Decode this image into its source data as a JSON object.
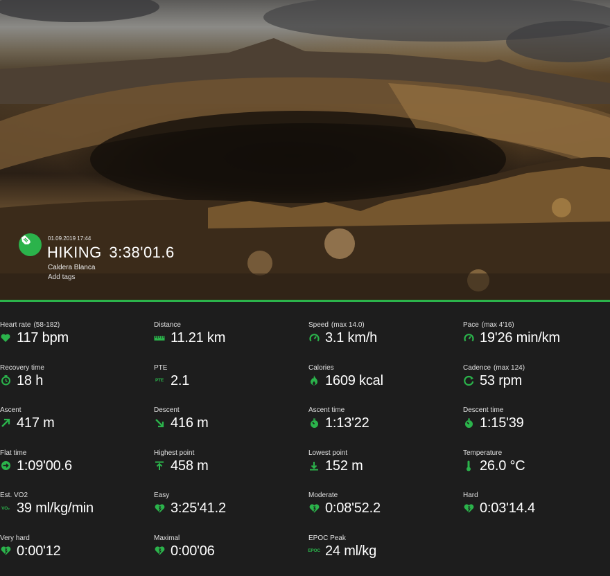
{
  "activity": {
    "date": "01.09.2019 17:44",
    "type": "HIKING",
    "duration": "3:38'01.6",
    "location": "Caldera Blanca",
    "add_tags": "Add tags",
    "icon": "hiking-boot-icon"
  },
  "colors": {
    "accent": "#2bb34b",
    "background": "#1d1d1d"
  },
  "stats": [
    {
      "label": "Heart rate",
      "sub": "(58-182)",
      "value": "117 bpm",
      "icon": "heart-icon"
    },
    {
      "label": "Distance",
      "sub": "",
      "value": "11.21 km",
      "icon": "ruler-icon"
    },
    {
      "label": "Speed",
      "sub": "(max  14.0)",
      "value": "3.1 km/h",
      "icon": "speedometer-icon"
    },
    {
      "label": "Pace",
      "sub": "(max  4'16)",
      "value": "19'26 min/km",
      "icon": "speedometer-icon"
    },
    {
      "label": "Recovery time",
      "sub": "",
      "value": "18 h",
      "icon": "recovery-icon"
    },
    {
      "label": "PTE",
      "sub": "",
      "value": "2.1",
      "icon": "pte-icon",
      "icon_text": "PTE"
    },
    {
      "label": "Calories",
      "sub": "",
      "value": "1609 kcal",
      "icon": "flame-icon"
    },
    {
      "label": "Cadence",
      "sub": "(max  124)",
      "value": "53 rpm",
      "icon": "cadence-icon"
    },
    {
      "label": "Ascent",
      "sub": "",
      "value": "417 m",
      "icon": "arrow-up-right-icon"
    },
    {
      "label": "Descent",
      "sub": "",
      "value": "416 m",
      "icon": "arrow-down-right-icon"
    },
    {
      "label": "Ascent time",
      "sub": "",
      "value": "1:13'22",
      "icon": "stopwatch-icon"
    },
    {
      "label": "Descent time",
      "sub": "",
      "value": "1:15'39",
      "icon": "stopwatch-icon"
    },
    {
      "label": "Flat time",
      "sub": "",
      "value": "1:09'00.6",
      "icon": "flat-time-icon"
    },
    {
      "label": "Highest point",
      "sub": "",
      "value": "458 m",
      "icon": "highest-point-icon"
    },
    {
      "label": "Lowest point",
      "sub": "",
      "value": "152 m",
      "icon": "lowest-point-icon"
    },
    {
      "label": "Temperature",
      "sub": "",
      "value": "26.0 °C",
      "icon": "thermometer-icon"
    },
    {
      "label": "Est. VO2",
      "sub": "",
      "value": "39 ml/kg/min",
      "icon": "vo2-icon",
      "icon_text": "VO₂"
    },
    {
      "label": "Easy",
      "sub": "",
      "value": "3:25'41.2",
      "icon": "heart-zone-icon"
    },
    {
      "label": "Moderate",
      "sub": "",
      "value": "0:08'52.2",
      "icon": "heart-zone-icon"
    },
    {
      "label": "Hard",
      "sub": "",
      "value": "0:03'14.4",
      "icon": "heart-zone-icon"
    },
    {
      "label": "Very hard",
      "sub": "",
      "value": "0:00'12",
      "icon": "heart-zone-icon"
    },
    {
      "label": "Maximal",
      "sub": "",
      "value": "0:00'06",
      "icon": "heart-zone-icon"
    },
    {
      "label": "EPOC Peak",
      "sub": "",
      "value": "24 ml/kg",
      "icon": "epoc-icon",
      "icon_text": "EPOC"
    }
  ]
}
